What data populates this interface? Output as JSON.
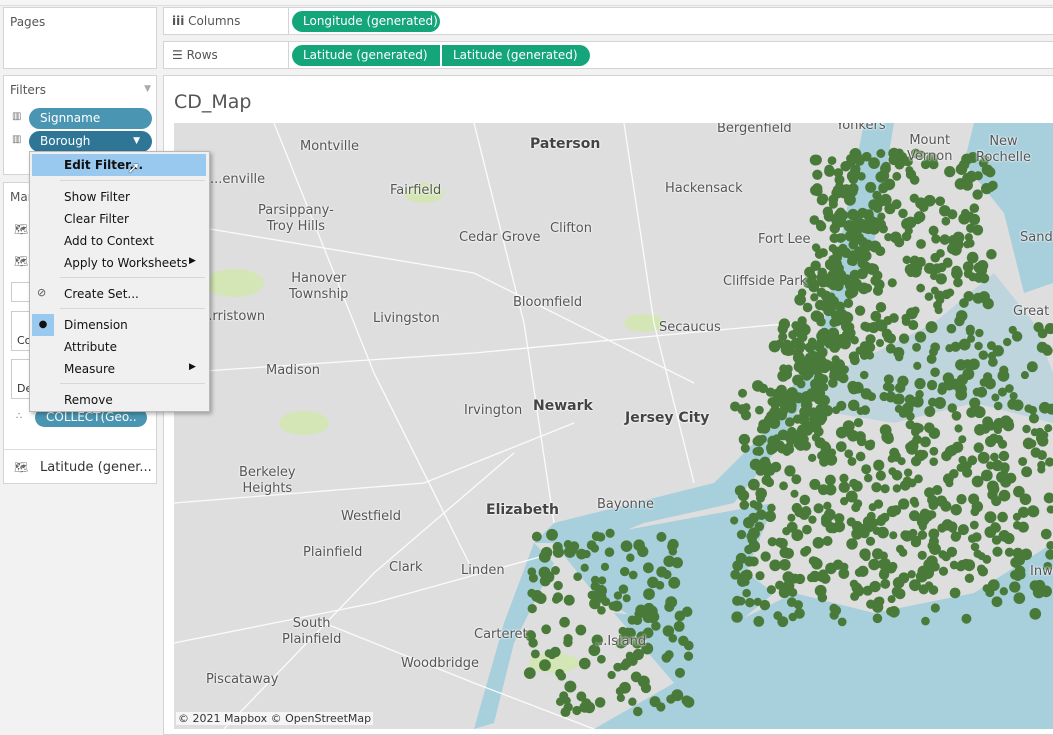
{
  "pages": {
    "title": "Pages"
  },
  "filters": {
    "title": "Filters",
    "items": [
      {
        "label": "Signname"
      },
      {
        "label": "Borough"
      }
    ]
  },
  "marks": {
    "title": "Marks",
    "color_label": "Color",
    "detail_label": "Detail",
    "collect_pill": "COLLECT(Geo..",
    "latitude_item": "Latitude (gener..."
  },
  "shelves": {
    "columns_label": "Columns",
    "rows_label": "Rows",
    "columns": [
      "Longitude (generated)"
    ],
    "rows": [
      "Latitude (generated)",
      "Latitude (generated)"
    ]
  },
  "sheet": {
    "title": "CD_Map"
  },
  "context_menu": {
    "items": [
      "Edit Filter...",
      "Show Filter",
      "Clear Filter",
      "Add to Context",
      "Apply to Worksheets",
      "Create Set...",
      "Dimension",
      "Attribute",
      "Measure",
      "Remove"
    ],
    "selected": "Dimension",
    "highlighted": "Edit Filter..."
  },
  "map": {
    "attribution": "© 2021 Mapbox © OpenStreetMap",
    "labels": [
      "Bergenfield",
      "Yonkers",
      "Mount\nVernon",
      "New\nRochelle",
      "Montville",
      "Paterson",
      "Fairfield",
      "Hackensack",
      "...enville",
      "Parsippany-\nTroy Hills",
      "Cedar Grove",
      "Clifton",
      "Fort Lee",
      "Sand..",
      "Hanover\nTownship",
      "Bloomfield",
      "Cliffside Park",
      "Great",
      "...rristown",
      "Livingston",
      "Secaucus",
      "Madison",
      "Irvington",
      "Newark",
      "Jersey City",
      "Berkeley\nHeights",
      "Bayonne",
      "Elizabeth",
      "Westfield",
      "Plainfield",
      "Clark",
      "Linden",
      "Inwood",
      "Carteret",
      "South\nPlainfield",
      "...Island",
      "Woodbridge",
      "Piscataway"
    ],
    "colors": {
      "land": "#dedede",
      "water": "#a8cfdc",
      "park": "#d4e6b5",
      "marks": "#4a7a3a"
    }
  }
}
